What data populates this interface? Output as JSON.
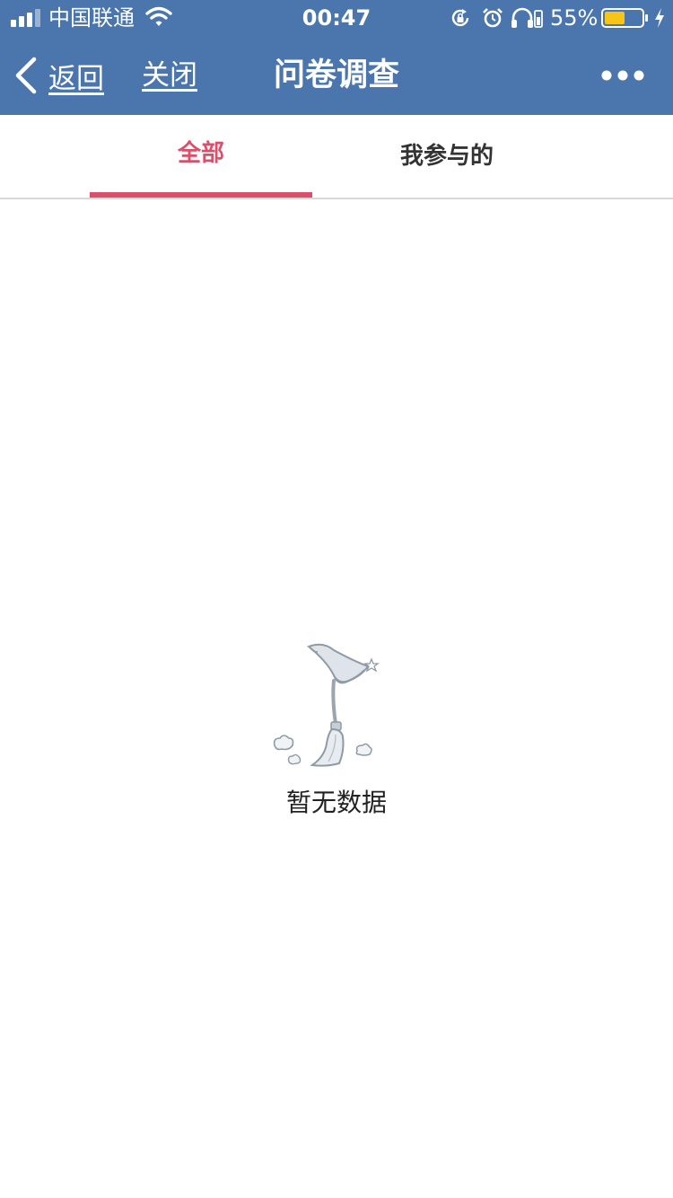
{
  "status_bar": {
    "carrier": "中国联通",
    "time": "00:47",
    "battery_percent": "55%",
    "battery_level": 0.55,
    "icons": [
      "signal-icon",
      "wifi-icon",
      "rotation-lock-icon",
      "alarm-icon",
      "headphones-icon",
      "battery-icon",
      "charging-icon"
    ]
  },
  "nav": {
    "back_label": "返回",
    "close_label": "关闭",
    "title": "问卷调查",
    "more_icon": "more-dots-icon"
  },
  "tabs": [
    {
      "label": "全部",
      "active": true
    },
    {
      "label": "我参与的",
      "active": false
    }
  ],
  "empty_state": {
    "message": "暂无数据",
    "icon": "witch-hat-broom-icon"
  },
  "colors": {
    "header_bg": "#4a76ad",
    "accent": "#d9506c",
    "battery_fill": "#f5c518"
  }
}
